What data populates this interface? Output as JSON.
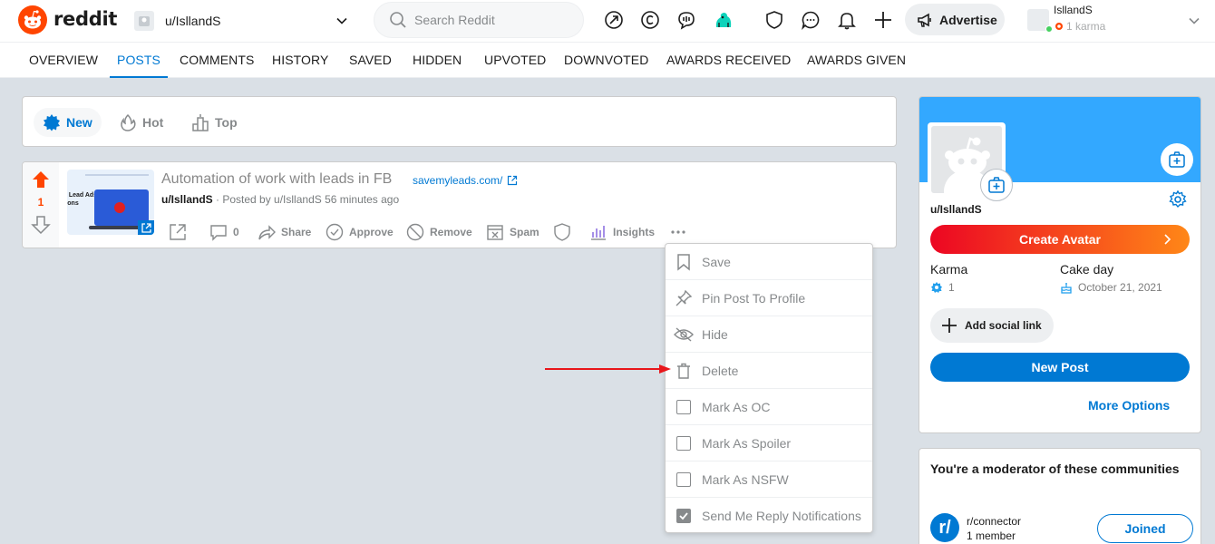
{
  "header": {
    "brand": "reddit",
    "user_switcher_label": "u/IsllandS",
    "search_placeholder": "Search Reddit",
    "advertise_label": "Advertise",
    "username": "IsllandS",
    "karma_label": "1 karma",
    "icons": [
      "popular-icon",
      "coins-icon",
      "chat-bubble-icon",
      "snoo-icon",
      "mod-shield-icon",
      "chat-icon",
      "notifications-icon",
      "create-post-icon",
      "megaphone-icon"
    ]
  },
  "tabs": [
    {
      "label": "OVERVIEW"
    },
    {
      "label": "POSTS",
      "active": true
    },
    {
      "label": "COMMENTS"
    },
    {
      "label": "HISTORY"
    },
    {
      "label": "SAVED"
    },
    {
      "label": "HIDDEN"
    },
    {
      "label": "UPVOTED"
    },
    {
      "label": "DOWNVOTED"
    },
    {
      "label": "AWARDS RECEIVED"
    },
    {
      "label": "AWARDS GIVEN"
    }
  ],
  "sort": [
    {
      "label": "New",
      "active": true
    },
    {
      "label": "Hot"
    },
    {
      "label": "Top"
    }
  ],
  "post": {
    "score": "1",
    "title": "Automation of work with leads in FB",
    "domain": "savemyleads.com/",
    "author": "u/IsllandS",
    "meta": " · Posted by u/IsllandS 56 minutes ago",
    "thumbnail_text": "k Lead Ads tions",
    "actions": {
      "comments": "0",
      "share": "Share",
      "approve": "Approve",
      "remove": "Remove",
      "spam": "Spam",
      "insights": "Insights"
    }
  },
  "dropdown": {
    "items": [
      {
        "label": "Save",
        "icon": "bookmark-icon"
      },
      {
        "label": "Pin Post To Profile",
        "icon": "pin-icon"
      },
      {
        "label": "Hide",
        "icon": "hide-icon"
      },
      {
        "label": "Delete",
        "icon": "trash-icon"
      },
      {
        "label": "Mark As OC",
        "checked": false
      },
      {
        "label": "Mark As Spoiler",
        "checked": false
      },
      {
        "label": "Mark As NSFW",
        "checked": false
      },
      {
        "label": "Send Me Reply Notifications",
        "checked": true
      }
    ]
  },
  "sidebar": {
    "username": "u/IsllandS",
    "create_avatar": "Create Avatar",
    "karma_label": "Karma",
    "karma_value": "1",
    "cakeday_label": "Cake day",
    "cakeday_value": "October 21, 2021",
    "social_link": "Add social link",
    "new_post": "New Post",
    "more_options": "More Options"
  },
  "moderator": {
    "title": "You're a moderator of these communities",
    "community_icon": "r/",
    "community": "r/connector",
    "members": "1 member",
    "joined": "Joined"
  },
  "colors": {
    "accent": "#0079d3",
    "upvote": "#ff4500",
    "banner": "#33a8ff",
    "annotation_arrow": "#e8161b"
  }
}
